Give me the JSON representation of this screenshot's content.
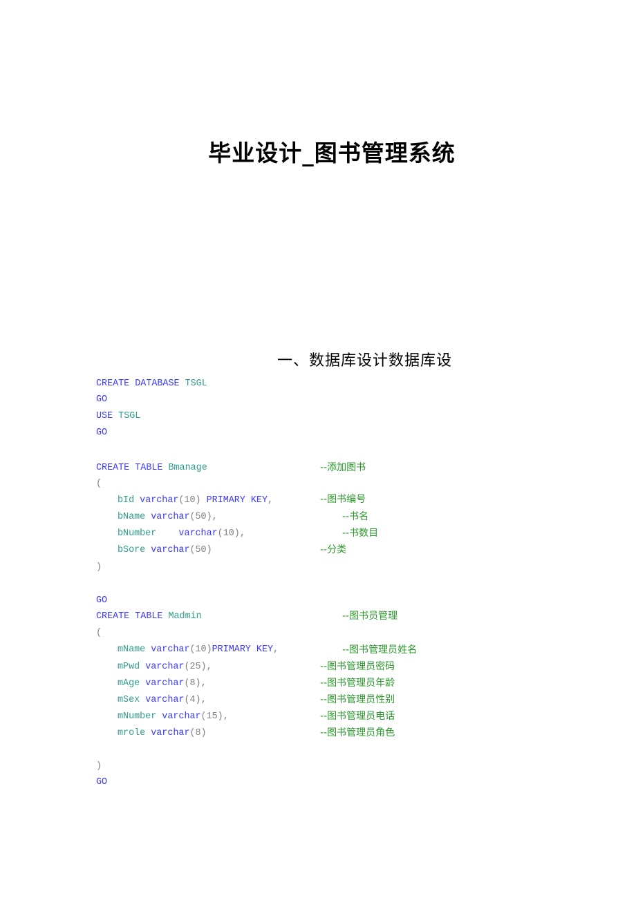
{
  "document": {
    "title": "毕业设计_图书管理系统",
    "section_heading": "一、数据库设计数据库设"
  },
  "code": {
    "db_block": {
      "create_kw": "CREATE DATABASE",
      "db_name": "TSGL",
      "go1": "GO",
      "use_kw": "USE",
      "use_name": "TSGL",
      "go2": "GO"
    },
    "bmanage": {
      "create_kw": "CREATE TABLE",
      "table_name": "Bmanage",
      "comment": "--添加图书",
      "open_paren": "(",
      "close_paren": ")",
      "columns": [
        {
          "name": "bId",
          "type": "varchar",
          "args": "(10)",
          "extra": " PRIMARY KEY",
          "trail": ",",
          "comment": "--图书编号"
        },
        {
          "name": "bName",
          "type": "varchar",
          "args": "(50)",
          "extra": "",
          "trail": ",",
          "comment": "--书名"
        },
        {
          "name": "bNumber",
          "type": "varchar",
          "args": "(10)",
          "extra": "",
          "trail": ",",
          "comment": "--书数目"
        },
        {
          "name": "bSore",
          "type": "varchar",
          "args": "(50)",
          "extra": "",
          "trail": "",
          "comment": "--分类"
        }
      ],
      "go": "GO"
    },
    "madmin": {
      "create_kw": "CREATE TABLE",
      "table_name": "Madmin",
      "comment": "--图书员管理",
      "open_paren": "(",
      "close_paren": ")",
      "columns": [
        {
          "name": "mName",
          "type": "varchar",
          "args": "(10)",
          "extra": "PRIMARY KEY",
          "trail": ",",
          "comment": "--图书管理员姓名"
        },
        {
          "name": "mPwd",
          "type": "varchar",
          "args": "(25)",
          "extra": "",
          "trail": ",",
          "comment": "--图书管理员密码"
        },
        {
          "name": "mAge",
          "type": "varchar",
          "args": "(8)",
          "extra": "",
          "trail": ",",
          "comment": "--图书管理员年龄"
        },
        {
          "name": "mSex",
          "type": "varchar",
          "args": "(4)",
          "extra": "",
          "trail": ",",
          "comment": "--图书管理员性别"
        },
        {
          "name": "mNumber",
          "type": "varchar",
          "args": "(15)",
          "extra": "",
          "trail": ",",
          "comment": "--图书管理员电话"
        },
        {
          "name": "mrole",
          "type": "varchar",
          "args": "(8)",
          "extra": "",
          "trail": "",
          "comment": "--图书管理员角色"
        }
      ],
      "go": "GO"
    }
  },
  "colors": {
    "keyword": "#3b3bf5",
    "identifier": "#2e9e8a",
    "punctuation": "#808080",
    "comment": "#2a9a2a"
  }
}
